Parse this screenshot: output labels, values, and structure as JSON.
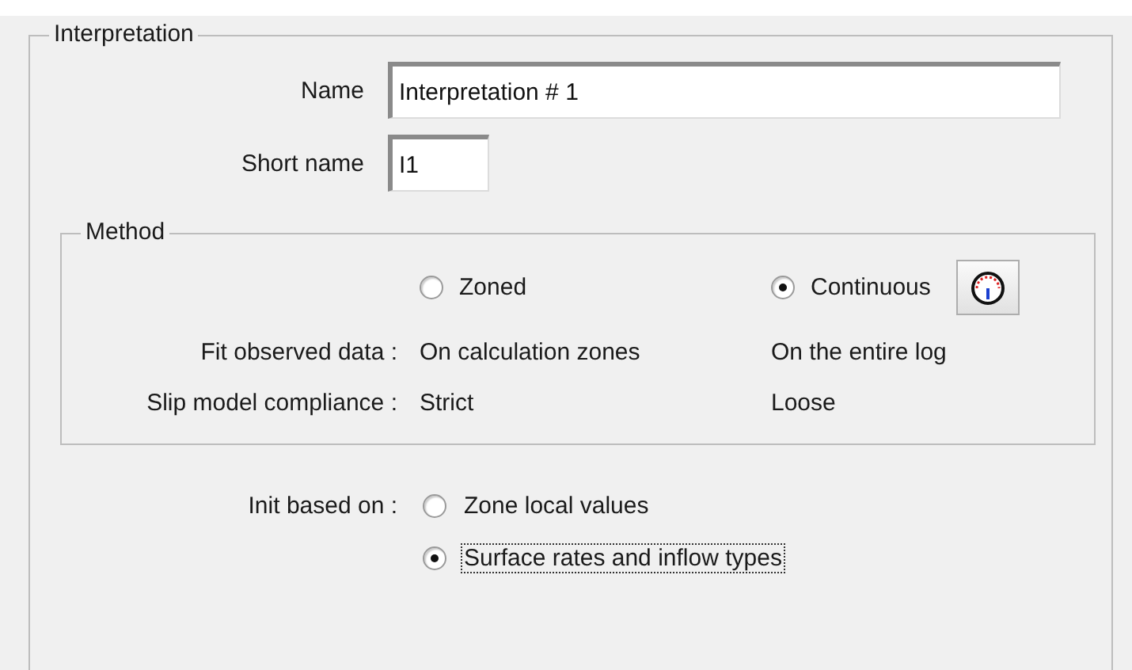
{
  "group": {
    "title": "Interpretation"
  },
  "fields": [
    {
      "label": "Name",
      "value": "Interpretation # 1",
      "kind": "wide"
    },
    {
      "label": "Short name",
      "value": "I1",
      "kind": "short"
    }
  ],
  "method": {
    "title": "Method",
    "options": [
      {
        "label": "Zoned",
        "selected": false
      },
      {
        "label": "Continuous",
        "selected": true
      }
    ],
    "rows": [
      {
        "label": "Fit observed data :",
        "values": [
          "On calculation zones",
          "On the entire log"
        ]
      },
      {
        "label": "Slip model compliance :",
        "values": [
          "Strict",
          "Loose"
        ]
      }
    ]
  },
  "init": {
    "label": "Init based on :",
    "options": [
      {
        "label": "Zone local values",
        "selected": false,
        "focused": false
      },
      {
        "label": "Surface rates and inflow types",
        "selected": true,
        "focused": true
      }
    ]
  }
}
